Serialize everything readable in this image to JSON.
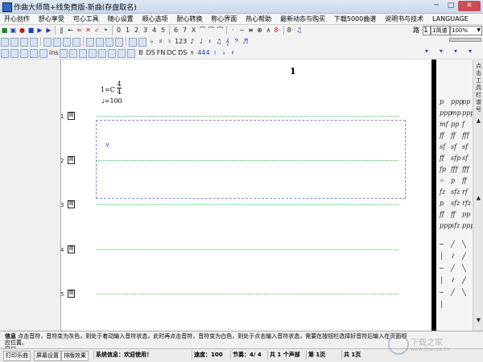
{
  "window": {
    "title": "作曲大师简+线免费版-新曲(存盘取名)",
    "min_label": "─",
    "max_label": "□",
    "close_label": "✕"
  },
  "menu": [
    "开心创作",
    "舒心享受",
    "可心工具",
    "随心设置",
    "顺心选项",
    "耐心转换",
    "称心界面",
    "热心帮助",
    "最新动态与购买",
    "下载5000曲谱",
    "说明书与技术",
    "LANGUAGE"
  ],
  "toolbar1": {
    "buttons": [
      {
        "label": "■",
        "color": "green",
        "icon": "new-file-icon"
      },
      {
        "label": "▣",
        "color": "blue",
        "icon": "open-file-icon"
      },
      {
        "label": "●",
        "color": "red",
        "icon": "record-icon"
      },
      {
        "label": "■",
        "color": "blue",
        "icon": "stop-icon"
      },
      {
        "label": "▶",
        "color": "blue",
        "icon": "play-icon"
      },
      {
        "label": "▶",
        "color": "blue",
        "icon": "play-from-icon"
      },
      {
        "label": "∥",
        "color": "",
        "icon": "pause-icon"
      },
      {
        "label": "←",
        "color": "",
        "icon": "back-icon"
      },
      {
        "label": "≈",
        "color": "red",
        "icon": "repeat-icon"
      },
      {
        "label": "✕",
        "color": "red",
        "icon": "delete-icon"
      },
      {
        "label": "✓",
        "color": "red",
        "icon": "check-icon"
      },
      {
        "label": "•",
        "color": "",
        "icon": "dot-icon"
      },
      {
        "label": "0",
        "color": "",
        "icon": "num-0"
      },
      {
        "label": "1",
        "color": "",
        "icon": "num-1"
      },
      {
        "label": "2",
        "color": "",
        "icon": "num-2"
      },
      {
        "label": "3",
        "color": "",
        "icon": "num-3"
      },
      {
        "label": "4",
        "color": "",
        "icon": "num-4"
      },
      {
        "label": "5",
        "color": "",
        "icon": "num-5"
      },
      {
        "label": "6",
        "color": "",
        "icon": "num-6"
      },
      {
        "label": "7",
        "color": "",
        "icon": "num-7"
      },
      {
        "label": "X",
        "color": "",
        "icon": "x-icon"
      },
      {
        "label": "⌒",
        "color": "",
        "icon": "slur-icon"
      },
      {
        "label": "⌒",
        "color": "",
        "icon": "tie-icon"
      },
      {
        "label": "⌒",
        "color": "",
        "icon": "phrase-icon"
      },
      {
        "label": "·",
        "color": "",
        "icon": "stacc-icon"
      },
      {
        "label": "~",
        "color": "",
        "icon": "trill-icon"
      },
      {
        "label": "≡",
        "color": "",
        "icon": "tremolo-icon"
      },
      {
        "label": "⊕",
        "color": "",
        "icon": "ornament-icon"
      },
      {
        "label": "∧",
        "color": "",
        "icon": "accent-icon"
      },
      {
        "label": "8·",
        "color": "red",
        "icon": "octave-icon"
      },
      {
        "label": "8·",
        "color": "",
        "icon": "octave-down-icon"
      },
      {
        "label": "♫",
        "color": "blue",
        "icon": "beam-icon"
      }
    ]
  },
  "toolbar2": {
    "buttons": [
      {
        "label": "♭",
        "color": "",
        "icon": "flat-icon"
      },
      {
        "label": "♯",
        "color": "",
        "icon": "sharp-icon"
      },
      {
        "label": "♮",
        "color": "",
        "icon": "natural-icon"
      },
      {
        "label": "123",
        "color": "",
        "icon": "tuplet-icon"
      },
      {
        "label": "♪",
        "color": "",
        "icon": "eighth-icon"
      },
      {
        "label": "♩",
        "color": "",
        "icon": "quarter-icon"
      },
      {
        "label": "𝄽",
        "color": "",
        "icon": "rest-icon"
      },
      {
        "label": "♫",
        "color": "blue",
        "icon": "triplet-icon"
      },
      {
        "label": "𝄞",
        "color": "blue",
        "icon": "clef-icon"
      },
      {
        "label": "𝄢",
        "color": "blue",
        "icon": "bass-clef-icon"
      },
      {
        "label": "♬",
        "color": "blue",
        "icon": "beam-group-icon"
      }
    ]
  },
  "toolbar3": {
    "ins_label": "ins",
    "buttons": [
      {
        "label": "B",
        "color": "",
        "icon": "bold-icon"
      },
      {
        "label": "DS",
        "color": "",
        "icon": "ds-icon"
      },
      {
        "label": "FN",
        "color": "",
        "icon": "fine-icon"
      },
      {
        "label": "DC",
        "color": "",
        "icon": "dc-icon"
      },
      {
        "label": "DS",
        "color": "",
        "icon": "dalsegno-icon"
      },
      {
        "label": "𝄋",
        "color": "",
        "icon": "segno-icon"
      },
      {
        "label": "444",
        "color": "blue",
        "icon": "measure-icon"
      },
      {
        "label": "♮",
        "color": "blue",
        "icon": "natural2-icon"
      },
      {
        "label": "♭",
        "color": "blue",
        "icon": "flat2-icon"
      },
      {
        "label": "♯",
        "color": "blue",
        "icon": "sharp2-icon"
      }
    ],
    "arrows": [
      "▾",
      "▾",
      "▾",
      "▾",
      "▾"
    ]
  },
  "right_controls": {
    "lu_label": "路",
    "lu_value": "1",
    "gear_value": "1简谱",
    "zoom_value": "100%"
  },
  "score": {
    "page_number": "1",
    "key_text": "1=C",
    "time_sig_top": "4",
    "time_sig_bottom": "4",
    "tempo": "♩=100",
    "cursor": "v",
    "box_label": "简",
    "lines": [
      {
        "num": "1"
      },
      {
        "num": "2"
      },
      {
        "num": "3"
      },
      {
        "num": "4"
      },
      {
        "num": "5"
      }
    ]
  },
  "palette": {
    "items": [
      "p",
      "ppp",
      "pp",
      "ppp",
      "mp",
      "ppp",
      "mf",
      "pp",
      "f",
      "ff",
      "ff",
      "fff",
      "sf",
      "sf",
      "sf",
      "ff",
      "sfp",
      "sf",
      "fp",
      "fff",
      "fff",
      "𝄐",
      "p",
      "ff",
      "fz",
      "sfz",
      "rf",
      "p",
      "sfz",
      "rfz",
      "ff",
      "ff",
      "pp",
      "ppp",
      "sfz",
      "ppp"
    ]
  },
  "right_scroll": {
    "items": [
      "点",
      "击",
      "工",
      "具",
      "栏",
      "谱",
      "号"
    ]
  },
  "info": {
    "label": "信息",
    "text": "点击音符，音符变为灰色，则处于着动输入音符状态，此时再点击音符，音符变为白色，则处于点击输入音符状态，需要在按钮栏选择好音符后输入在页面相应位置。",
    "extra": "窗口"
  },
  "status": {
    "tabs": [
      "打印乐曲",
      "屏幕设置",
      "排版效果"
    ],
    "sys_info": "系统信息：欢迎使用！",
    "speed": "速度：100",
    "beat": "节奏：4/ 4",
    "parts": "共 1 个声部",
    "page": "第 1页",
    "total": "共 1页"
  },
  "watermark": {
    "text": "下载之家",
    "sub": "www.downza.cn"
  }
}
